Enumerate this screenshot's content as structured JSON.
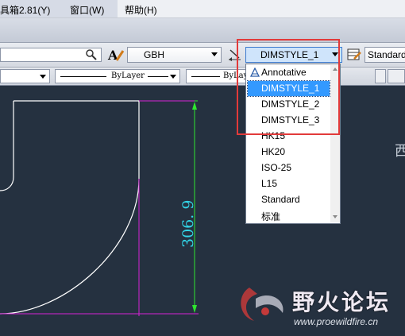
{
  "menu": {
    "items": [
      {
        "label": "具箱2.81(Y)"
      },
      {
        "label": "窗口(W)"
      },
      {
        "label": "帮助(H)"
      }
    ]
  },
  "toolbar": {
    "search_field_value": "",
    "text_style": {
      "value": "GBH"
    },
    "dim_style": {
      "value": "DIMSTYLE_1"
    },
    "table_style": {
      "value": "Standard"
    },
    "layer_row": {
      "linetype": {
        "value": "ByLayer"
      },
      "lineweight": {
        "value": "ByLayer"
      },
      "plotstyle": {
        "value": "ByLay"
      }
    }
  },
  "dropdown": {
    "items": [
      {
        "label": "Annotative",
        "icon": "annotative-icon"
      },
      {
        "label": "DIMSTYLE_1",
        "selected": true
      },
      {
        "label": "DIMSTYLE_2"
      },
      {
        "label": "DIMSTYLE_3"
      },
      {
        "label": "HK15"
      },
      {
        "label": "HK20"
      },
      {
        "label": "ISO-25"
      },
      {
        "label": "L15"
      },
      {
        "label": "Standard"
      },
      {
        "label": "标准"
      }
    ]
  },
  "drawing": {
    "dimension_text": "306. 9",
    "colors": {
      "background": "#253140",
      "geometry": "#ffffff",
      "dimension_line": "#2fe62f",
      "dimension_text": "#32d6e8",
      "extension": "#d622d6"
    }
  },
  "watermark": {
    "title": "野火论坛",
    "url": "www.proewildfire.cn"
  },
  "edge_text": "西",
  "colors": {
    "highlight": "#e23a3a",
    "selection": "#3399ff"
  }
}
